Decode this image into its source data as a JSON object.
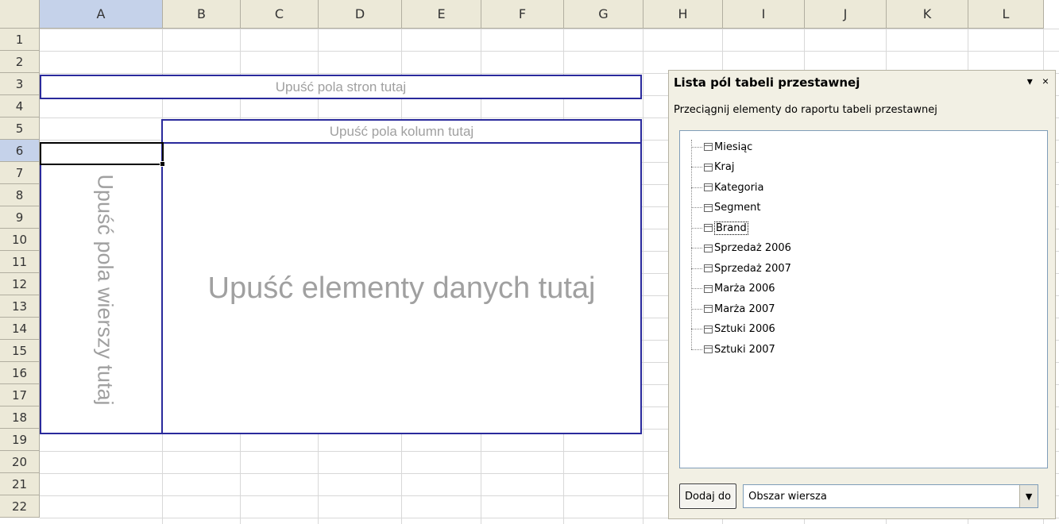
{
  "columns": [
    {
      "label": "A",
      "width": 155,
      "active": true
    },
    {
      "label": "B",
      "width": 98
    },
    {
      "label": "C",
      "width": 98
    },
    {
      "label": "D",
      "width": 105
    },
    {
      "label": "E",
      "width": 100
    },
    {
      "label": "F",
      "width": 104
    },
    {
      "label": "G",
      "width": 100
    },
    {
      "label": "H",
      "width": 100
    },
    {
      "label": "I",
      "width": 103
    },
    {
      "label": "J",
      "width": 103
    },
    {
      "label": "K",
      "width": 103
    },
    {
      "label": "L",
      "width": 95
    }
  ],
  "rows": [
    "1",
    "2",
    "3",
    "4",
    "5",
    "6",
    "7",
    "8",
    "9",
    "10",
    "11",
    "12",
    "13",
    "14",
    "15",
    "16",
    "17",
    "18",
    "19",
    "20",
    "21",
    "22"
  ],
  "active_row": "6",
  "drop_zones": {
    "page": "Upuść pola stron tutaj",
    "column": "Upuść pola kolumn tutaj",
    "row": "Upuść pola wierszy tutaj",
    "data": "Upuść elementy danych tutaj"
  },
  "panel": {
    "title": "Lista pól tabeli przestawnej",
    "dropdown_icon": "▾",
    "close_icon": "×",
    "description": "Przeciągnij elementy do raportu tabeli przestawnej",
    "fields": [
      "Miesiąc",
      "Kraj",
      "Kategoria",
      "Segment",
      "Brand",
      "Sprzedaż 2006",
      "Sprzedaż 2007",
      "Marża 2006",
      "Marża 2007",
      "Sztuki 2006",
      "Sztuki 2007"
    ],
    "selected_field": "Brand",
    "add_button": "Dodaj do",
    "area_select_value": "Obszar wiersza",
    "area_select_arrow": "▼"
  }
}
